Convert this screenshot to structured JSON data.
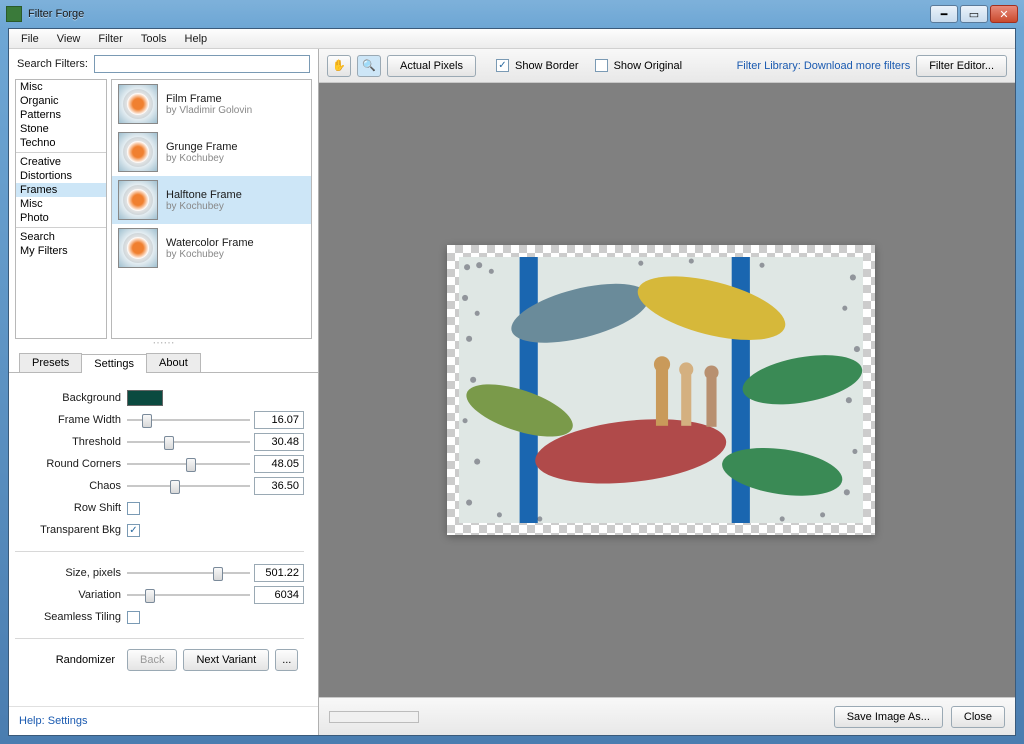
{
  "window": {
    "title": "Filter Forge"
  },
  "menu": [
    "File",
    "View",
    "Filter",
    "Tools",
    "Help"
  ],
  "search": {
    "label": "Search Filters:",
    "value": ""
  },
  "categories": {
    "groups": [
      [
        "Misc",
        "Organic",
        "Patterns",
        "Stone",
        "Techno"
      ],
      [
        "Creative",
        "Distortions",
        "Frames",
        "Misc",
        "Photo"
      ],
      [
        "Search",
        "My Filters"
      ]
    ],
    "selected": "Frames"
  },
  "filters": [
    {
      "name": "Film Frame",
      "author": "by Vladimir Golovin"
    },
    {
      "name": "Grunge Frame",
      "author": "by Kochubey"
    },
    {
      "name": "Halftone Frame",
      "author": "by Kochubey",
      "selected": true
    },
    {
      "name": "Watercolor Frame",
      "author": "by Kochubey"
    }
  ],
  "tabs": {
    "items": [
      "Presets",
      "Settings",
      "About"
    ],
    "selected": "Settings"
  },
  "settings": {
    "background": {
      "label": "Background",
      "color": "#0b4a40"
    },
    "frame_width": {
      "label": "Frame Width",
      "value": "16.07",
      "pos": 12
    },
    "threshold": {
      "label": "Threshold",
      "value": "30.48",
      "pos": 30
    },
    "round_corners": {
      "label": "Round Corners",
      "value": "48.05",
      "pos": 48
    },
    "chaos": {
      "label": "Chaos",
      "value": "36.50",
      "pos": 35
    },
    "row_shift": {
      "label": "Row Shift",
      "checked": false
    },
    "transparent_bkg": {
      "label": "Transparent Bkg",
      "checked": true
    },
    "size_pixels": {
      "label": "Size, pixels",
      "value": "501.22",
      "pos": 70
    },
    "variation": {
      "label": "Variation",
      "value": "6034",
      "pos": 15
    },
    "seamless": {
      "label": "Seamless Tiling",
      "checked": false
    },
    "randomizer": {
      "label": "Randomizer",
      "back": "Back",
      "next": "Next Variant",
      "more": "..."
    }
  },
  "help_link": "Help: Settings",
  "toolbar": {
    "actual_pixels": "Actual Pixels",
    "show_border": "Show Border",
    "show_border_checked": true,
    "show_original": "Show Original",
    "show_original_checked": false,
    "library_link": "Filter Library: Download more filters",
    "filter_editor": "Filter Editor..."
  },
  "bottombar": {
    "save": "Save Image As...",
    "close": "Close"
  }
}
